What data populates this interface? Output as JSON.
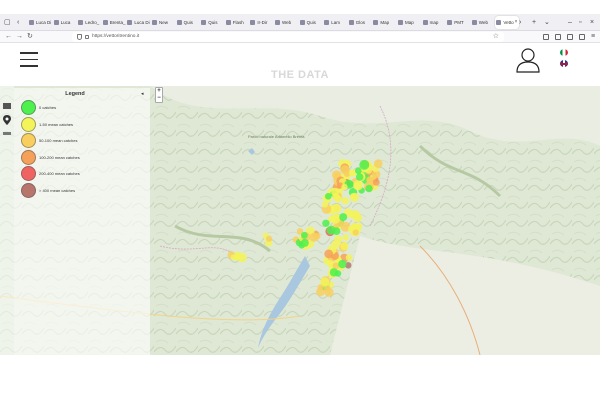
{
  "browser": {
    "tabs": [
      {
        "label": "Luca Di"
      },
      {
        "label": "Luca"
      },
      {
        "label": "Ledro_"
      },
      {
        "label": "Brenta_"
      },
      {
        "label": "Luca Di"
      },
      {
        "label": "New"
      },
      {
        "label": "Quis"
      },
      {
        "label": "Quis"
      },
      {
        "label": "Flash"
      },
      {
        "label": "Ir-Dir"
      },
      {
        "label": "Web"
      },
      {
        "label": "Quis"
      },
      {
        "label": "Lam"
      },
      {
        "label": "Glos"
      },
      {
        "label": "Map"
      },
      {
        "label": "Map"
      },
      {
        "label": "map"
      },
      {
        "label": "PMT"
      },
      {
        "label": "Web"
      },
      {
        "label": "Vetto"
      }
    ],
    "url": "https://vettoritrentino.it"
  },
  "header": {
    "title": "THE DATA"
  },
  "legend": {
    "title": "Legend",
    "items": [
      {
        "label": "0 catches",
        "color": "#4ef04e"
      },
      {
        "label": "1-50 mean catches",
        "color": "#f3f35a"
      },
      {
        "label": "50-100 mean catches",
        "color": "#f8cf5e"
      },
      {
        "label": "100-200 mean catches",
        "color": "#f6a15a"
      },
      {
        "label": "200-400 mean catches",
        "color": "#f06363"
      },
      {
        "label": "> 400 mean catches",
        "color": "#b7756c"
      }
    ]
  },
  "map": {
    "zoom_in": "+",
    "zoom_out": "−",
    "park_label": "Parco naturale Adamello Brenta"
  }
}
